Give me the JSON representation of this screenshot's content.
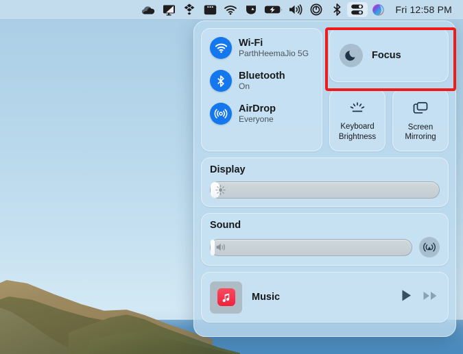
{
  "menubar": {
    "icons": [
      {
        "name": "onedrive-icon",
        "glyph": "cloud"
      },
      {
        "name": "display-capture-icon",
        "glyph": "monitor"
      },
      {
        "name": "dropbox-icon",
        "glyph": "dropbox"
      },
      {
        "name": "window-manager-icon",
        "glyph": "window"
      },
      {
        "name": "wifi-icon",
        "glyph": "wifi"
      },
      {
        "name": "notch-app-icon",
        "glyph": "notch"
      },
      {
        "name": "battery-charging-icon",
        "glyph": "battery"
      },
      {
        "name": "volume-icon",
        "glyph": "speaker"
      },
      {
        "name": "onepassword-icon",
        "glyph": "onepassword"
      },
      {
        "name": "bluetooth-icon",
        "glyph": "bluetooth"
      },
      {
        "name": "control-center-icon",
        "glyph": "toggles"
      },
      {
        "name": "siri-icon",
        "glyph": "siri"
      }
    ],
    "clock": "Fri 12:58 PM"
  },
  "control_center": {
    "connectivity": [
      {
        "title": "Wi-Fi",
        "status": "ParthHeemaJio 5G",
        "icon": "wifi-icon"
      },
      {
        "title": "Bluetooth",
        "status": "On",
        "icon": "bluetooth-icon"
      },
      {
        "title": "AirDrop",
        "status": "Everyone",
        "icon": "airdrop-icon"
      }
    ],
    "focus": {
      "label": "Focus",
      "icon": "moon-icon"
    },
    "tiles": [
      {
        "label_line1": "Keyboard",
        "label_line2": "Brightness",
        "icon": "keyboard-brightness-icon"
      },
      {
        "label_line1": "Screen",
        "label_line2": "Mirroring",
        "icon": "screen-mirroring-icon"
      }
    ],
    "display": {
      "title": "Display",
      "value_percent": 4,
      "icon": "brightness-icon"
    },
    "sound": {
      "title": "Sound",
      "value_percent": 2,
      "icon": "speaker-icon",
      "airplay_icon": "airplay-icon"
    },
    "music": {
      "title": "Music",
      "app_icon": "apple-music-icon",
      "play_label": "Play",
      "next_label": "Fast Forward"
    }
  },
  "annotation": {
    "highlight_color": "#ee1b1b",
    "target": "Focus"
  }
}
